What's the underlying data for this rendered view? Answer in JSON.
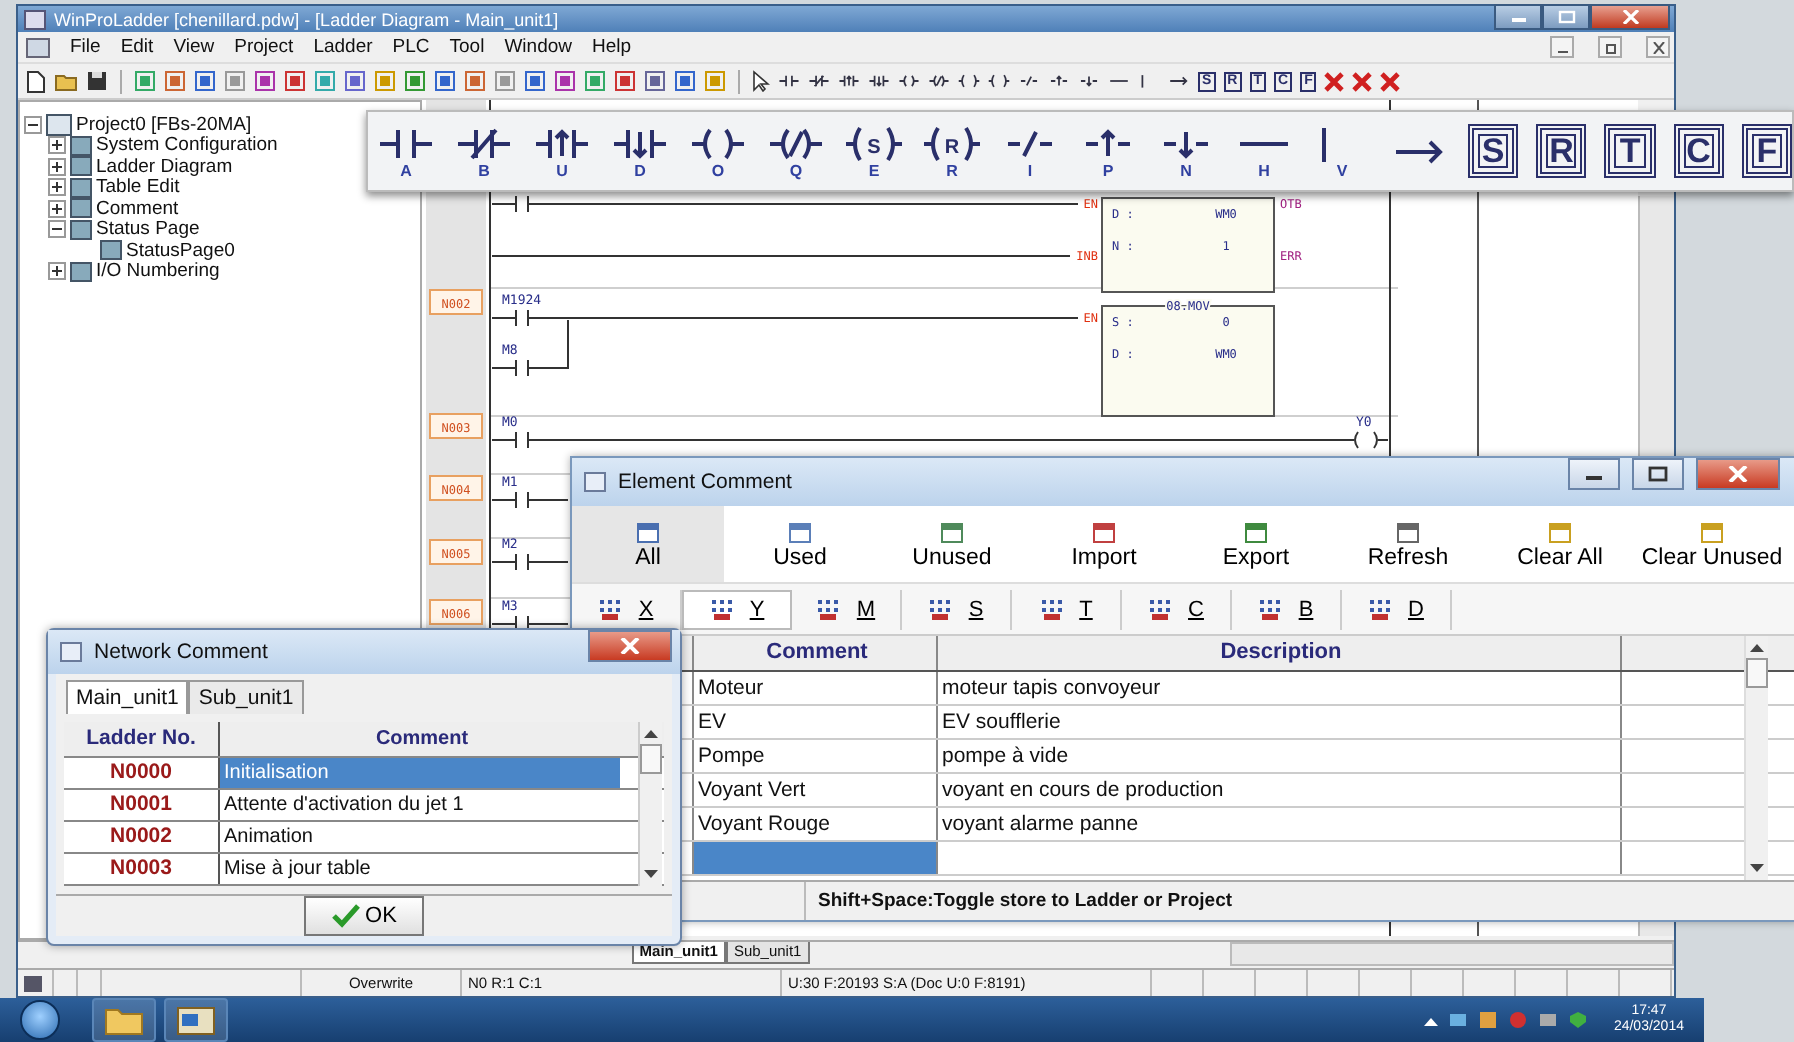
{
  "window": {
    "title": "WinProLadder [chenillard.pdw] - [Ladder Diagram - Main_unit1]"
  },
  "menu": [
    "File",
    "Edit",
    "View",
    "Project",
    "Ladder",
    "PLC",
    "Tool",
    "Window",
    "Help"
  ],
  "toolbar": {
    "small_boxed": [
      "S",
      "R",
      "T",
      "C",
      "F"
    ]
  },
  "tree": [
    {
      "label": "Project0 [FBs-20MA]",
      "expanded": true,
      "children": [
        {
          "label": "System Configuration",
          "expanded": false
        },
        {
          "label": "Ladder Diagram",
          "expanded": false
        },
        {
          "label": "Table Edit",
          "expanded": false
        },
        {
          "label": "Comment",
          "expanded": false
        },
        {
          "label": "Status Page",
          "expanded": true,
          "children": [
            {
              "label": "StatusPage0"
            }
          ]
        },
        {
          "label": "I/O Numbering",
          "expanded": false
        }
      ]
    }
  ],
  "ladder": {
    "rung_labels": [
      "N002",
      "N003",
      "N004",
      "N005",
      "N006"
    ],
    "contacts": [
      "M1924",
      "M8",
      "M0",
      "M1",
      "M2",
      "M3"
    ],
    "coil": "Y0",
    "blocks": [
      {
        "inputs": [
          "EN",
          "INB"
        ],
        "outputs": [
          "OTB",
          "ERR"
        ],
        "params": [
          {
            "name": "D :",
            "value": "WM0"
          },
          {
            "name": "N :",
            "value": "1"
          }
        ]
      },
      {
        "title": "08.MOV",
        "inputs": [
          "EN"
        ],
        "params": [
          {
            "name": "S :",
            "value": "0"
          },
          {
            "name": "D :",
            "value": "WM0"
          }
        ]
      }
    ],
    "sheet_tabs": [
      {
        "label": "Main_unit1",
        "selected": true
      },
      {
        "label": "Sub_unit1",
        "selected": false
      }
    ]
  },
  "instruction_toolbar": [
    {
      "kind": "no_contact",
      "key": "A"
    },
    {
      "kind": "nc_contact",
      "key": "B"
    },
    {
      "kind": "rise_contact",
      "key": "U"
    },
    {
      "kind": "fall_contact",
      "key": "D"
    },
    {
      "kind": "coil",
      "key": "O"
    },
    {
      "kind": "inverted_coil",
      "key": "Q"
    },
    {
      "kind": "set_coil",
      "mark": "S",
      "key": "E"
    },
    {
      "kind": "reset_coil",
      "mark": "R",
      "key": "R"
    },
    {
      "kind": "not",
      "key": "I"
    },
    {
      "kind": "rise",
      "key": "P"
    },
    {
      "kind": "fall",
      "key": "N"
    },
    {
      "kind": "hline",
      "key": "H"
    },
    {
      "kind": "vline",
      "key": "V"
    },
    {
      "kind": "arrow"
    },
    {
      "kind": "boxed",
      "label": "S"
    },
    {
      "kind": "boxed",
      "label": "R"
    },
    {
      "kind": "boxed",
      "label": "T"
    },
    {
      "kind": "boxed",
      "label": "C"
    },
    {
      "kind": "boxed",
      "label": "F"
    }
  ],
  "element_comment": {
    "title": "Element Comment",
    "actions": [
      {
        "label": "All",
        "selected": true
      },
      {
        "label": "Used",
        "selected": false
      },
      {
        "label": "Unused",
        "selected": false
      },
      {
        "label": "Import",
        "selected": false
      },
      {
        "label": "Export",
        "selected": false
      },
      {
        "label": "Refresh",
        "selected": false
      },
      {
        "label": "Clear All",
        "selected": false
      },
      {
        "label": "Clear Unused",
        "selected": false
      }
    ],
    "types": [
      {
        "label": "X",
        "selected": false
      },
      {
        "label": "Y",
        "selected": true
      },
      {
        "label": "M",
        "selected": false
      },
      {
        "label": "S",
        "selected": false
      },
      {
        "label": "T",
        "selected": false
      },
      {
        "label": "C",
        "selected": false
      },
      {
        "label": "B",
        "selected": false
      },
      {
        "label": "D",
        "selected": false
      }
    ],
    "columns": [
      "Comment",
      "Description"
    ],
    "rows": [
      {
        "comment": "Moteur",
        "description": "moteur tapis convoyeur"
      },
      {
        "comment": "EV",
        "description": "EV soufflerie"
      },
      {
        "comment": "Pompe",
        "description": "pompe à vide"
      },
      {
        "comment": "Voyant Vert",
        "description": "voyant en cours de production"
      },
      {
        "comment": "Voyant Rouge",
        "description": "voyant alarme panne"
      }
    ],
    "new_row_selected": true,
    "status": "Shift+Space:Toggle store to Ladder or Project"
  },
  "network_comment": {
    "title": "Network Comment",
    "tabs": [
      {
        "label": "Main_unit1",
        "selected": true
      },
      {
        "label": "Sub_unit1",
        "selected": false
      }
    ],
    "columns": [
      "Ladder No.",
      "Comment"
    ],
    "rows": [
      {
        "no": "N0000",
        "comment": "Initialisation",
        "selected": true
      },
      {
        "no": "N0001",
        "comment": "Attente d'activation du jet 1",
        "selected": false
      },
      {
        "no": "N0002",
        "comment": "Animation",
        "selected": false
      },
      {
        "no": "N0003",
        "comment": "Mise à jour table",
        "selected": false
      }
    ],
    "ok": "OK"
  },
  "status_bar": [
    "Overwrite",
    "N0 R:1 C:1",
    "U:30 F:20193 S:A (Doc U:0 F:8191)"
  ],
  "taskbar": {
    "time": "17:47",
    "date": "24/03/2014"
  }
}
